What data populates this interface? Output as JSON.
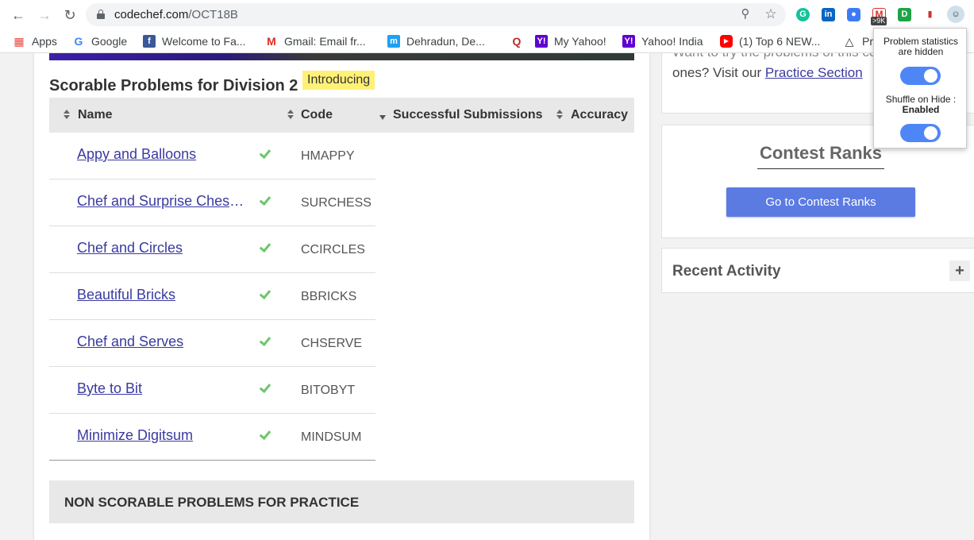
{
  "browser": {
    "url_host": "codechef.com",
    "url_path": "/OCT18B",
    "extension_badge": ">9K"
  },
  "bookmarks": [
    {
      "label": "Apps",
      "icon": "apps-grid-icon"
    },
    {
      "label": "Google",
      "icon": "google-icon"
    },
    {
      "label": "Welcome to Fa...",
      "icon": "facebook-icon"
    },
    {
      "label": "Gmail: Email fr...",
      "icon": "gmail-icon"
    },
    {
      "label": "Dehradun, De...",
      "icon": "m-icon"
    },
    {
      "label": "",
      "icon": "quora-icon"
    },
    {
      "label": "My Yahoo!",
      "icon": "yahoo-icon"
    },
    {
      "label": "Yahoo! India",
      "icon": "yahoo-icon"
    },
    {
      "label": "(1) Top 6 NEW...",
      "icon": "youtube-icon"
    },
    {
      "label": "Pr",
      "icon": "unity-icon"
    }
  ],
  "section_title": "Scorable Problems for Division 2",
  "intro_tag": "Introducing",
  "table": {
    "headers": {
      "name": "Name",
      "code": "Code",
      "submissions": "Successful Submissions",
      "accuracy": "Accuracy"
    },
    "rows": [
      {
        "name": "Appy and Balloons",
        "code": "HMAPPY"
      },
      {
        "name": "Chef and Surprise Chess...",
        "code": "SURCHESS"
      },
      {
        "name": "Chef and Circles",
        "code": "CCIRCLES"
      },
      {
        "name": "Beautiful Bricks",
        "code": "BBRICKS"
      },
      {
        "name": "Chef and Serves",
        "code": "CHSERVE"
      },
      {
        "name": "Byte to Bit",
        "code": "BITOBYT"
      },
      {
        "name": "Minimize Digitsum",
        "code": "MINDSUM"
      }
    ]
  },
  "non_scorable_title": "NON SCORABLE PROBLEMS FOR PRACTICE",
  "sidebar": {
    "practice_line1": "Want to try the problems of this con",
    "practice_line2_prefix": "ones? Visit our ",
    "practice_link": "Practice Section",
    "ranks_title": "Contest Ranks",
    "ranks_button": "Go to Contest Ranks",
    "recent_title": "Recent Activity",
    "recent_toggle": "+"
  },
  "popup": {
    "stats_line1": "Problem statistics",
    "stats_line2": "are hidden",
    "shuffle_line1": "Shuffle on Hide :",
    "shuffle_line2": "Enabled",
    "stats_toggle_on": true,
    "shuffle_toggle_on": true
  },
  "colors": {
    "link": "#3a3aa0",
    "check": "#6cc56c",
    "button": "#5b7be3",
    "toggle": "#4f86f7",
    "highlight": "#fff176"
  }
}
